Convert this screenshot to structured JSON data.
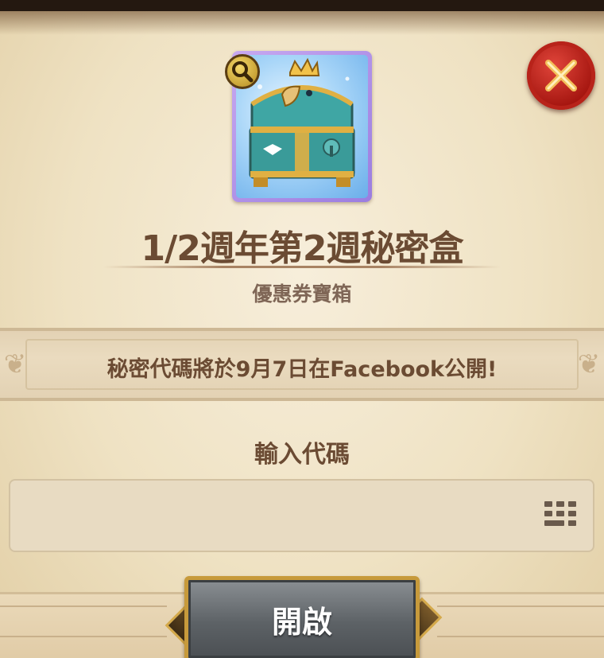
{
  "dialog": {
    "title": "1/2週年第2週秘密盒",
    "subtitle": "優惠券寶箱",
    "notice": "秘密代碼將於9月7日在Facebook公開!",
    "input_label": "輸入代碼",
    "input_value": "",
    "open_button_label": "開啟"
  },
  "icons": {
    "close": "close-x-icon",
    "magnify": "magnifier-icon",
    "keypad": "keypad-icon",
    "item": "treasure-chest-icon"
  },
  "colors": {
    "parchment": "#efe2c3",
    "title_text": "#6b4b33",
    "close_red": "#a4150f",
    "button_gray": "#5d6266",
    "button_gold": "#c79a3b",
    "card_border": "#9b7de0"
  }
}
